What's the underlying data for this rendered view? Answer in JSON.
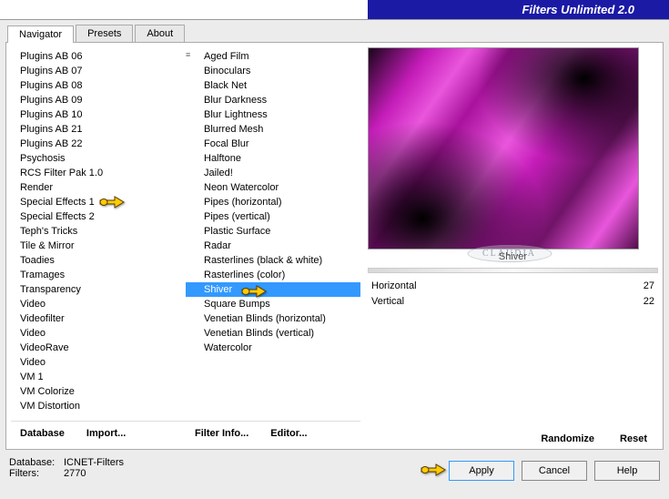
{
  "app_title": "Filters Unlimited 2.0",
  "tabs": [
    "Navigator",
    "Presets",
    "About"
  ],
  "active_tab": 0,
  "categories": [
    "Plugins AB 06",
    "Plugins AB 07",
    "Plugins AB 08",
    "Plugins AB 09",
    "Plugins AB 10",
    "Plugins AB 21",
    "Plugins AB 22",
    "Psychosis",
    "RCS Filter Pak 1.0",
    "Render",
    "Special Effects 1",
    "Special Effects 2",
    "Teph's Tricks",
    "Tile & Mirror",
    "Toadies",
    "Tramages",
    "Transparency",
    "Video",
    "Videofilter",
    "Video",
    "VideoRave",
    "Video",
    "VM 1",
    "VM Colorize",
    "VM Distortion"
  ],
  "category_pointed": 10,
  "filters": [
    "Aged Film",
    "Binoculars",
    "Black Net",
    "Blur Darkness",
    "Blur Lightness",
    "Blurred Mesh",
    "Focal Blur",
    "Halftone",
    "Jailed!",
    "Neon Watercolor",
    "Pipes (horizontal)",
    "Pipes (vertical)",
    "Plastic Surface",
    "Radar",
    "Rasterlines (black & white)",
    "Rasterlines (color)",
    "Shiver",
    "Square Bumps",
    "Venetian Blinds (horizontal)",
    "Venetian Blinds (vertical)",
    "Watercolor"
  ],
  "filter_selected": 16,
  "bottom_buttons": {
    "database": "Database",
    "import": "Import...",
    "filter_info": "Filter Info...",
    "editor": "Editor..."
  },
  "preview_label": "Shiver",
  "params": [
    {
      "name": "Horizontal",
      "value": 27
    },
    {
      "name": "Vertical",
      "value": 22
    }
  ],
  "randomize": "Randomize",
  "reset": "Reset",
  "footer": {
    "db_label": "Database:",
    "db_value": "ICNET-Filters",
    "filters_label": "Filters:",
    "filters_value": "2770",
    "apply": "Apply",
    "cancel": "Cancel",
    "help": "Help"
  },
  "watermark": "CLAUDIA"
}
